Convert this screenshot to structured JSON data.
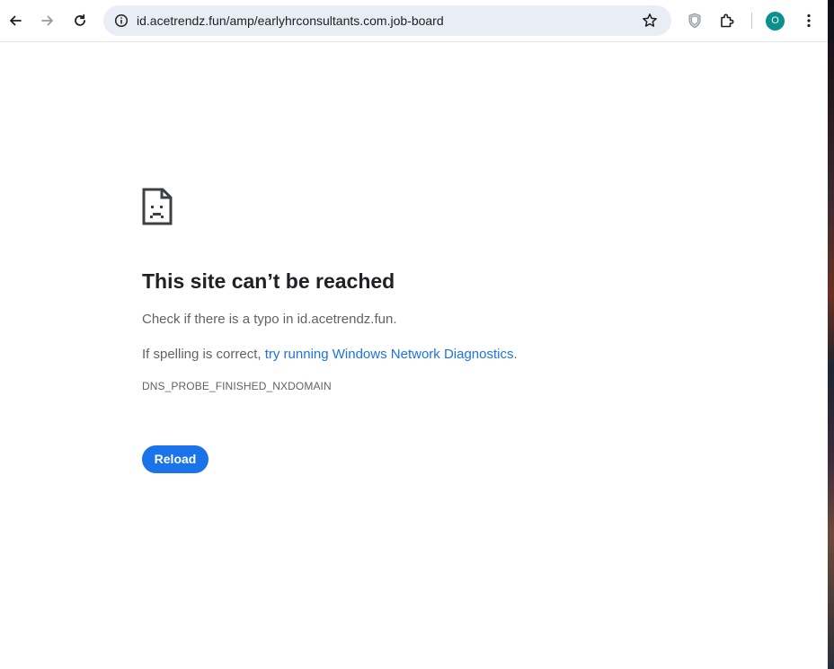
{
  "browser": {
    "url": "id.acetrendz.fun/amp/earlyhrconsultants.com.job-board",
    "profile_initial": "O",
    "accent_color": "#1a73e8",
    "icons": [
      "back-arrow-icon",
      "forward-arrow-icon",
      "reload-icon",
      "site-info-icon",
      "bookmark-star-icon",
      "shield-extension-icon",
      "extensions-puzzle-icon",
      "kebab-menu-icon"
    ]
  },
  "error_page": {
    "icon": "sad-document-icon",
    "title": "This site can’t be reached",
    "typo_text": "Check if there is a typo in id.acetrendz.fun.",
    "spelling_prefix": "If spelling is correct, ",
    "diagnostics_link": "try running Windows Network Diagnostics",
    "spelling_suffix": ".",
    "error_code": "DNS_PROBE_FINISHED_NXDOMAIN",
    "reload_label": "Reload"
  }
}
